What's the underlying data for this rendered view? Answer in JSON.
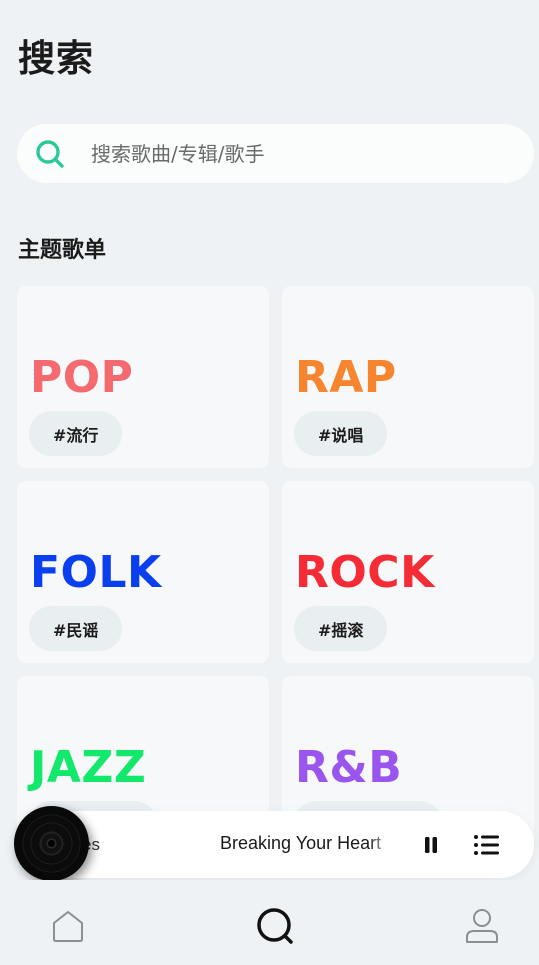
{
  "header": {
    "title": "搜索"
  },
  "search": {
    "placeholder": "搜索歌曲/专辑/歌手",
    "value": "",
    "icon": "search-icon",
    "accent": "#2bc99a"
  },
  "section": {
    "title": "主题歌单"
  },
  "playlists": [
    {
      "genre": "POP",
      "tag": "#流行",
      "color": "#f56a6f"
    },
    {
      "genre": "RAP",
      "tag": "#说唱",
      "color": "#f7852f"
    },
    {
      "genre": "FOLK",
      "tag": "#民谣",
      "color": "#0a3ff0"
    },
    {
      "genre": "ROCK",
      "tag": "#摇滚",
      "color": "#f52b36"
    },
    {
      "genre": "JAZZ",
      "tag": "",
      "color": "#12e86a"
    },
    {
      "genre": "R&B",
      "tag": "",
      "color": "#9b55ef"
    }
  ],
  "player": {
    "prev_song_fragment": "es",
    "song_title": "Breaking Your Heart",
    "pause_icon": "pause-icon",
    "playlist_icon": "playlist-icon"
  },
  "nav": {
    "items": [
      {
        "name": "home",
        "icon": "home-icon",
        "active": false
      },
      {
        "name": "search",
        "icon": "search-icon",
        "active": true
      },
      {
        "name": "profile",
        "icon": "user-icon",
        "active": false
      }
    ]
  }
}
